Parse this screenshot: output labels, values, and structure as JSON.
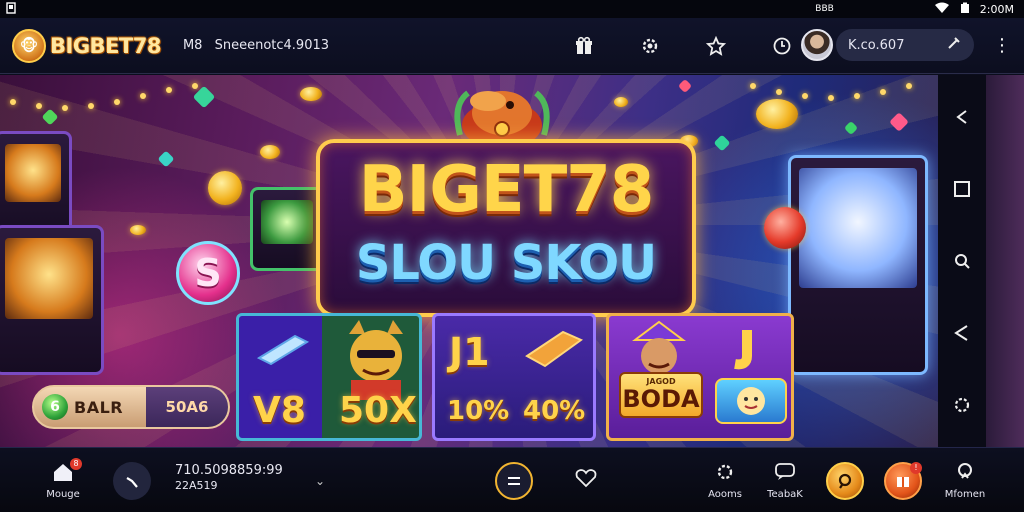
{
  "status_bar": {
    "left_icon": "notification-icon",
    "center_text": "BBB",
    "time": "2:00M",
    "icons": [
      "wifi-icon",
      "battery-icon"
    ]
  },
  "header": {
    "logo_text": "BIGBET78",
    "account_prefix": "M8",
    "account_id": "Sneeenotc4.9013",
    "icons": [
      "gift-icon",
      "settings-icon",
      "star-icon",
      "clock-icon"
    ],
    "search_text": "K.co.607",
    "search_icon": "tools-icon",
    "menu_icon": "more-vertical-icon"
  },
  "hero": {
    "title_line1": "BIGET78",
    "title_line2": "SLOU SKOU",
    "token_letter": "S",
    "balance": {
      "icon_letter": "6",
      "label": "BALR",
      "value": "50A6"
    },
    "cards": [
      {
        "left_value": "V8",
        "right_value": "50X"
      },
      {
        "left_value": "J1",
        "bottom_left": "10%",
        "bottom_right": "40%"
      },
      {
        "plaque_top": "JAGOD",
        "plaque_text": "BODA"
      }
    ]
  },
  "side_nav": {
    "icons": [
      "back-arrow-icon",
      "square-icon",
      "search-icon",
      "share-icon",
      "settings-icon"
    ]
  },
  "bottom_nav": {
    "home_label": "Mouge",
    "home_badge": "8",
    "numbers_line1": "710.5098859:99",
    "numbers_line2": "22A519",
    "items": [
      {
        "label": "Aooms",
        "icon": "gear-icon"
      },
      {
        "label": "TeabaK",
        "icon": "chat-icon"
      },
      {
        "label": "",
        "icon": "coin-icon"
      },
      {
        "label": "",
        "icon": "gift-icon",
        "badge": "!"
      },
      {
        "label": "Mfomen",
        "icon": "user-icon"
      }
    ]
  }
}
